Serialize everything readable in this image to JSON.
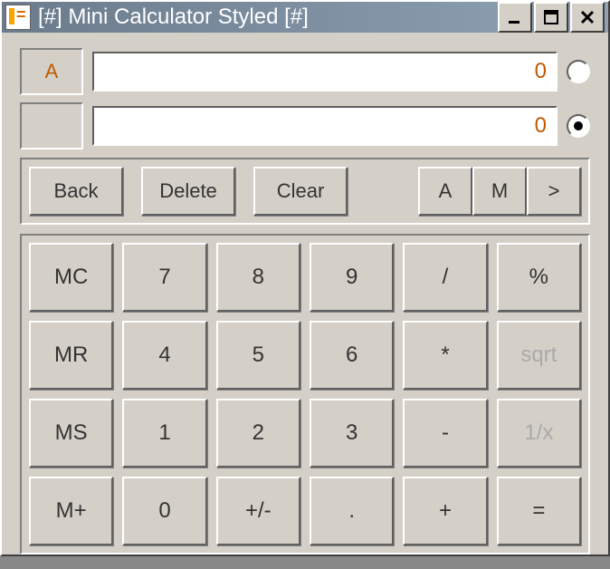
{
  "window": {
    "title": "[#] Mini Calculator Styled [#]"
  },
  "displays": {
    "a": {
      "label": "A",
      "value": "0",
      "radio_selected": false
    },
    "b": {
      "label": "",
      "value": "0",
      "radio_selected": true
    }
  },
  "edit": {
    "back": "Back",
    "delete": "Delete",
    "clear": "Clear",
    "a": "A",
    "m": "M",
    "more": ">"
  },
  "keys": {
    "mc": "MC",
    "mr": "MR",
    "ms": "MS",
    "mplus": "M+",
    "n7": "7",
    "n8": "8",
    "n9": "9",
    "n4": "4",
    "n5": "5",
    "n6": "6",
    "n1": "1",
    "n2": "2",
    "n3": "3",
    "n0": "0",
    "div": "/",
    "mul": "*",
    "sub": "-",
    "add": "+",
    "pct": "%",
    "sqrt": "sqrt",
    "inv": "1/x",
    "eq": "=",
    "sign": "+/-",
    "dot": "."
  }
}
